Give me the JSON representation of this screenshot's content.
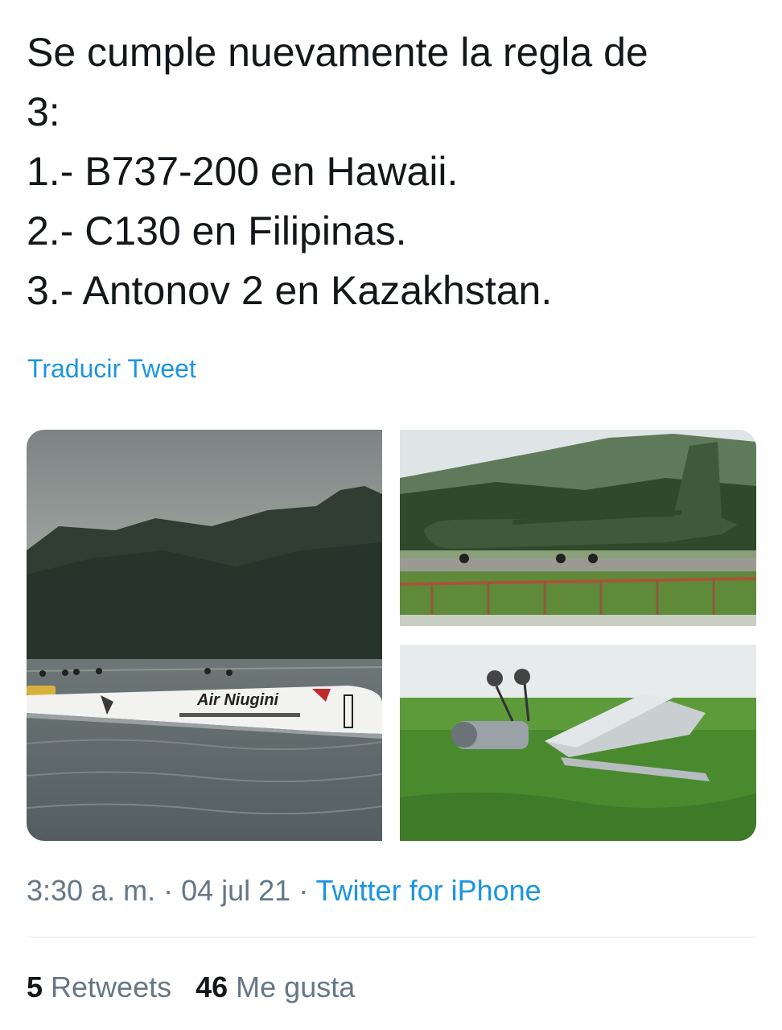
{
  "tweet": {
    "lines": [
      "Se cumple nuevamente la regla de",
      "3:",
      "1.- B737-200 en Hawaii.",
      "2.- C130 en Filipinas.",
      "3.- Antonov 2 en Kazakhstan."
    ],
    "translate_label": "Traducir Tweet"
  },
  "media": {
    "photos": [
      {
        "name": "photo-airniugini-water",
        "airline_text": "Air Niugini"
      },
      {
        "name": "photo-c130-runway"
      },
      {
        "name": "photo-antonov-overturned"
      }
    ]
  },
  "meta": {
    "time": "3:30 a. m.",
    "sep1": " · ",
    "date": "04 jul 21",
    "sep2": " · ",
    "source": "Twitter for iPhone"
  },
  "stats": {
    "retweets_count": "5",
    "retweets_label": " Retweets",
    "likes_count": "46",
    "likes_label": " Me gusta"
  },
  "colors": {
    "text": "#14171a",
    "secondary": "#657786",
    "link": "#1b95e0",
    "divider": "#e1e8ed"
  }
}
